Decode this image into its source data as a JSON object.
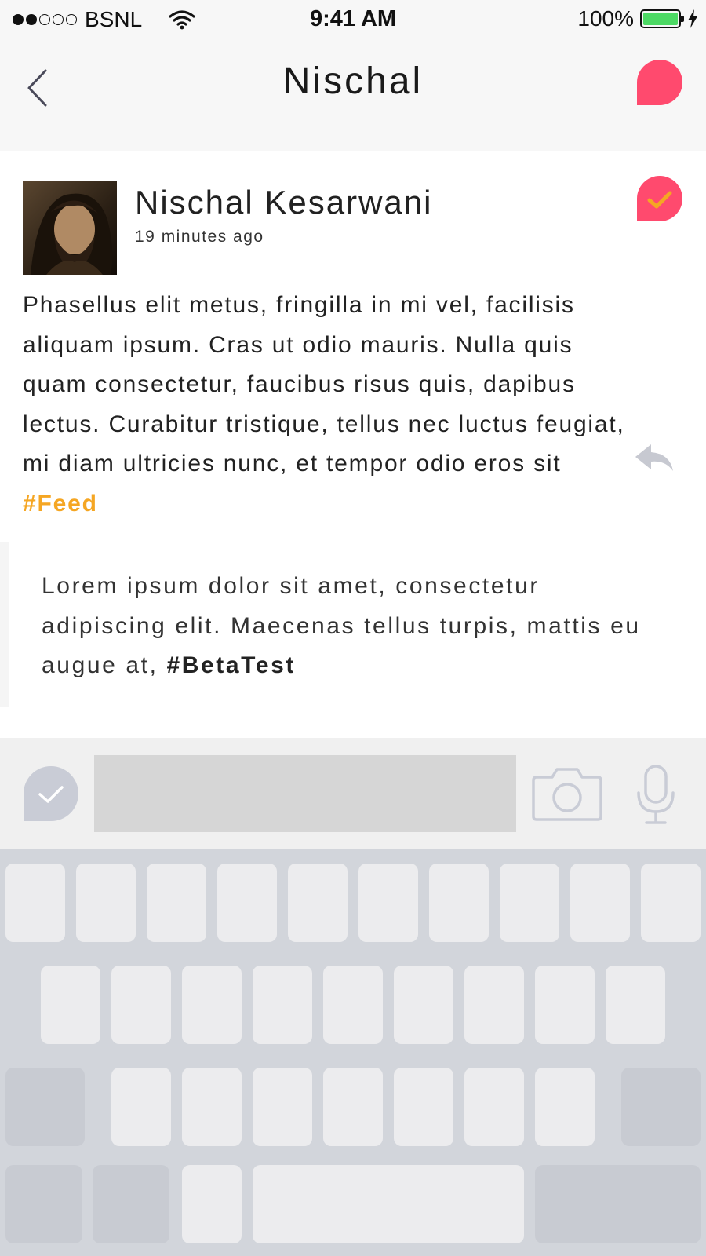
{
  "status_bar": {
    "carrier": "BSNL",
    "signal_strength": 2,
    "signal_max": 5,
    "time": "9:41 AM",
    "battery_percent": "100%",
    "battery_level": 1.0,
    "battery_color": "#4cd964",
    "icons": [
      "signal-dots-icon",
      "wifi-icon",
      "battery-icon",
      "charging-bolt-icon"
    ]
  },
  "nav": {
    "title": "Nischal",
    "back_icon": "chevron-left-icon",
    "action_icon": "speech-bubble-icon",
    "accent_color": "#ff4a6e"
  },
  "post": {
    "author": "Nischal Kesarwani",
    "time_ago": "19 minutes ago",
    "body": "Phasellus elit metus, fringilla in mi vel, facilisis aliquam ipsum. Cras ut odio mauris. Nulla quis quam consectetur, faucibus risus quis, dapibus lectus. Curabitur tristique, tellus nec luctus feugiat, mi diam ultricies nunc, et tempor odio eros sit ",
    "hashtag": "#Feed",
    "hashtag_color": "#f5a623",
    "badge_icon": "check-bubble-icon",
    "reply_icon": "reply-icon",
    "avatar_icon": "profile-photo"
  },
  "quote": {
    "text": "Lorem ipsum dolor sit amet, consectetur adipiscing elit. Maecenas tellus turpis, mattis eu augue at, ",
    "hashtag": "#BetaTest"
  },
  "composer": {
    "input_value": "",
    "avatar_icon": "check-bubble-icon",
    "camera_icon": "camera-icon",
    "mic_icon": "microphone-icon"
  },
  "keyboard": {
    "rows": 4,
    "key_color": "#ececee",
    "function_key_color": "#c8cbd2",
    "background_color": "#d2d5db"
  }
}
